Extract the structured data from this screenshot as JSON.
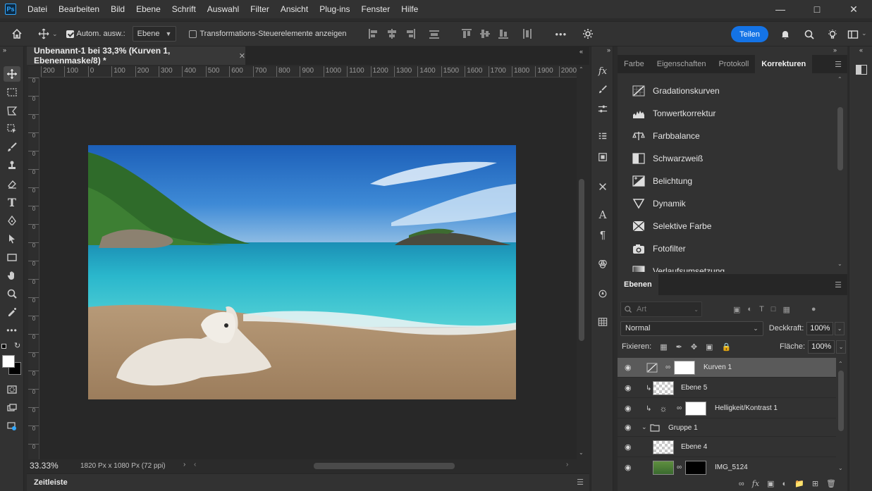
{
  "app": {
    "logo": "Ps"
  },
  "menu": [
    "Datei",
    "Bearbeiten",
    "Bild",
    "Ebene",
    "Schrift",
    "Auswahl",
    "Filter",
    "Ansicht",
    "Plug-ins",
    "Fenster",
    "Hilfe"
  ],
  "window_controls": [
    "minimize-icon",
    "maximize-icon",
    "close-icon"
  ],
  "options": {
    "auto_select_label": "Autom. ausw.:",
    "auto_select_checked": true,
    "auto_select_target": "Ebene",
    "transform_controls_label": "Transformations-Steuerelemente anzeigen",
    "more": "•••",
    "share_label": "Teilen"
  },
  "document": {
    "tab_title": "Unbenannt-1 bei 33,3% (Kurven 1, Ebenenmaske/8) *",
    "zoom": "33.33%",
    "info": "1820 Px x 1080 Px (72 ppi)"
  },
  "ruler_h": [
    "200",
    "100",
    "0",
    "100",
    "200",
    "300",
    "400",
    "500",
    "600",
    "700",
    "800",
    "900",
    "1000",
    "1100",
    "1200",
    "1300",
    "1400",
    "1500",
    "1600",
    "1700",
    "1800",
    "1900",
    "2000"
  ],
  "ruler_v": [
    "0",
    "0",
    "0",
    "0",
    "0",
    "0",
    "0",
    "0",
    "0",
    "0",
    "0",
    "0",
    "0",
    "0",
    "0",
    "0",
    "0",
    "0",
    "0",
    "0",
    "0"
  ],
  "timeline_label": "Zeitleiste",
  "panels": {
    "tabs": [
      "Farbe",
      "Eigenschaften",
      "Protokoll",
      "Korrekturen"
    ],
    "active_tab": "Korrekturen",
    "adjustments": [
      {
        "label": "Gradationskurven",
        "icon": "curves-icon"
      },
      {
        "label": "Tonwertkorrektur",
        "icon": "levels-icon"
      },
      {
        "label": "Farbbalance",
        "icon": "color-balance-icon"
      },
      {
        "label": "Schwarzweiß",
        "icon": "black-white-icon"
      },
      {
        "label": "Belichtung",
        "icon": "exposure-icon"
      },
      {
        "label": "Dynamik",
        "icon": "vibrance-icon"
      },
      {
        "label": "Selektive Farbe",
        "icon": "selective-color-icon"
      },
      {
        "label": "Fotofilter",
        "icon": "photo-filter-icon"
      },
      {
        "label": "Verlaufsumsetzung",
        "icon": "gradient-map-icon"
      }
    ]
  },
  "layers_panel": {
    "tab": "Ebenen",
    "filter_placeholder": "Art",
    "blend_mode": "Normal",
    "opacity_label": "Deckkraft:",
    "opacity": "100%",
    "lock_label": "Fixieren:",
    "fill_label": "Fläche:",
    "fill": "100%",
    "layers": [
      {
        "name": "Kurven 1",
        "selected": true
      },
      {
        "name": "Ebene 5",
        "selected": false
      },
      {
        "name": "Helligkeit/Kontrast 1",
        "selected": false
      },
      {
        "name": "Gruppe 1",
        "selected": false
      },
      {
        "name": "Ebene 4",
        "selected": false
      },
      {
        "name": "IMG_5124",
        "selected": false
      }
    ]
  },
  "colors": {
    "accent": "#1473e6",
    "bg": "#2b2b2b",
    "panel": "#323232"
  }
}
